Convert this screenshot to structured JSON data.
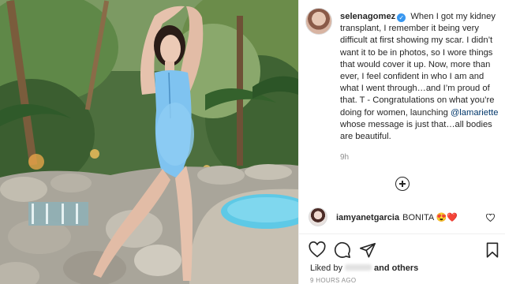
{
  "post": {
    "username": "selenagomez",
    "caption_text": "When I got my kidney transplant, I remember it being very difficult at first showing my scar. I didn’t want it to be in photos, so I wore things that would cover it up. Now, more than ever, I feel confident in who I am and what I went through…and I’m proud of that. T - Congratulations on what you’re doing for women, launching",
    "mention": "@lamariette",
    "caption_tail": "whose message is just that…all bodies are beautiful.",
    "timestamp": "9h"
  },
  "comment": {
    "username": "iamyanetgarcia",
    "text": "BONITA",
    "emojis": "😍❤️"
  },
  "likes": {
    "prefix": "Liked by",
    "suffix": "and others"
  },
  "time_ago": "9 HOURS AGO",
  "icons": {
    "like": "heart-icon",
    "comment": "comment-icon",
    "share": "paper-plane-icon",
    "save": "bookmark-icon",
    "more_comments": "plus-circle-icon",
    "verified": "verified-badge-icon"
  },
  "colors": {
    "verified": "#3897f0",
    "mention": "#00376b",
    "muted": "#8e8e8e",
    "swimsuit": "#7fc3f0",
    "pool": "#5ec9e6"
  }
}
